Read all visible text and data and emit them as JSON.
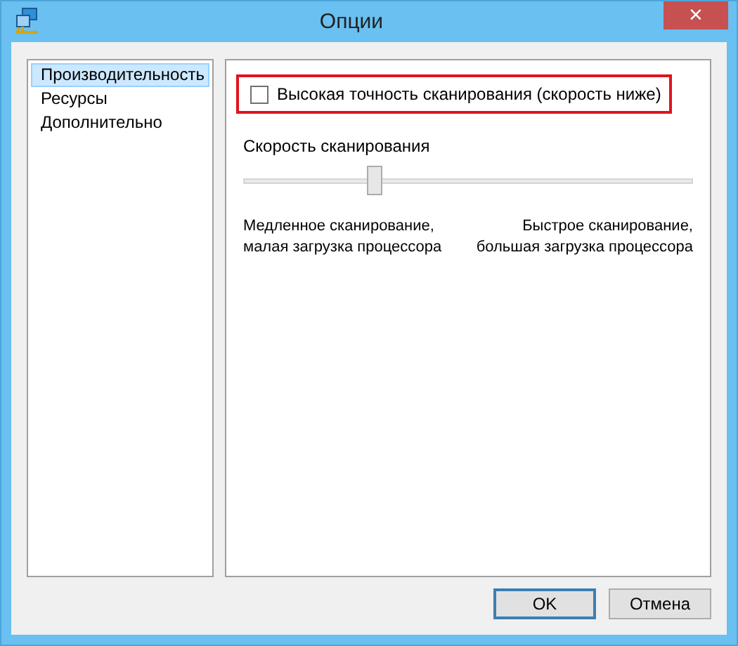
{
  "window": {
    "title": "Опции",
    "close": "×"
  },
  "sidebar": {
    "items": [
      {
        "label": "Производительность",
        "selected": true
      },
      {
        "label": "Ресурсы",
        "selected": false
      },
      {
        "label": "Дополнительно",
        "selected": false
      }
    ]
  },
  "panel": {
    "checkbox": {
      "label": "Высокая точность сканирования (скорость ниже)",
      "checked": false,
      "highlighted": true
    },
    "slider": {
      "label": "Скорость сканирования",
      "level": 0.29,
      "left_caption": "Медленное сканирование,\nмалая загрузка процессора",
      "right_caption": "Быстрое сканирование,\nбольшая загрузка процессора"
    }
  },
  "buttons": [
    {
      "label": "OK",
      "default": true
    },
    {
      "label": "Отмена",
      "default": false
    }
  ]
}
